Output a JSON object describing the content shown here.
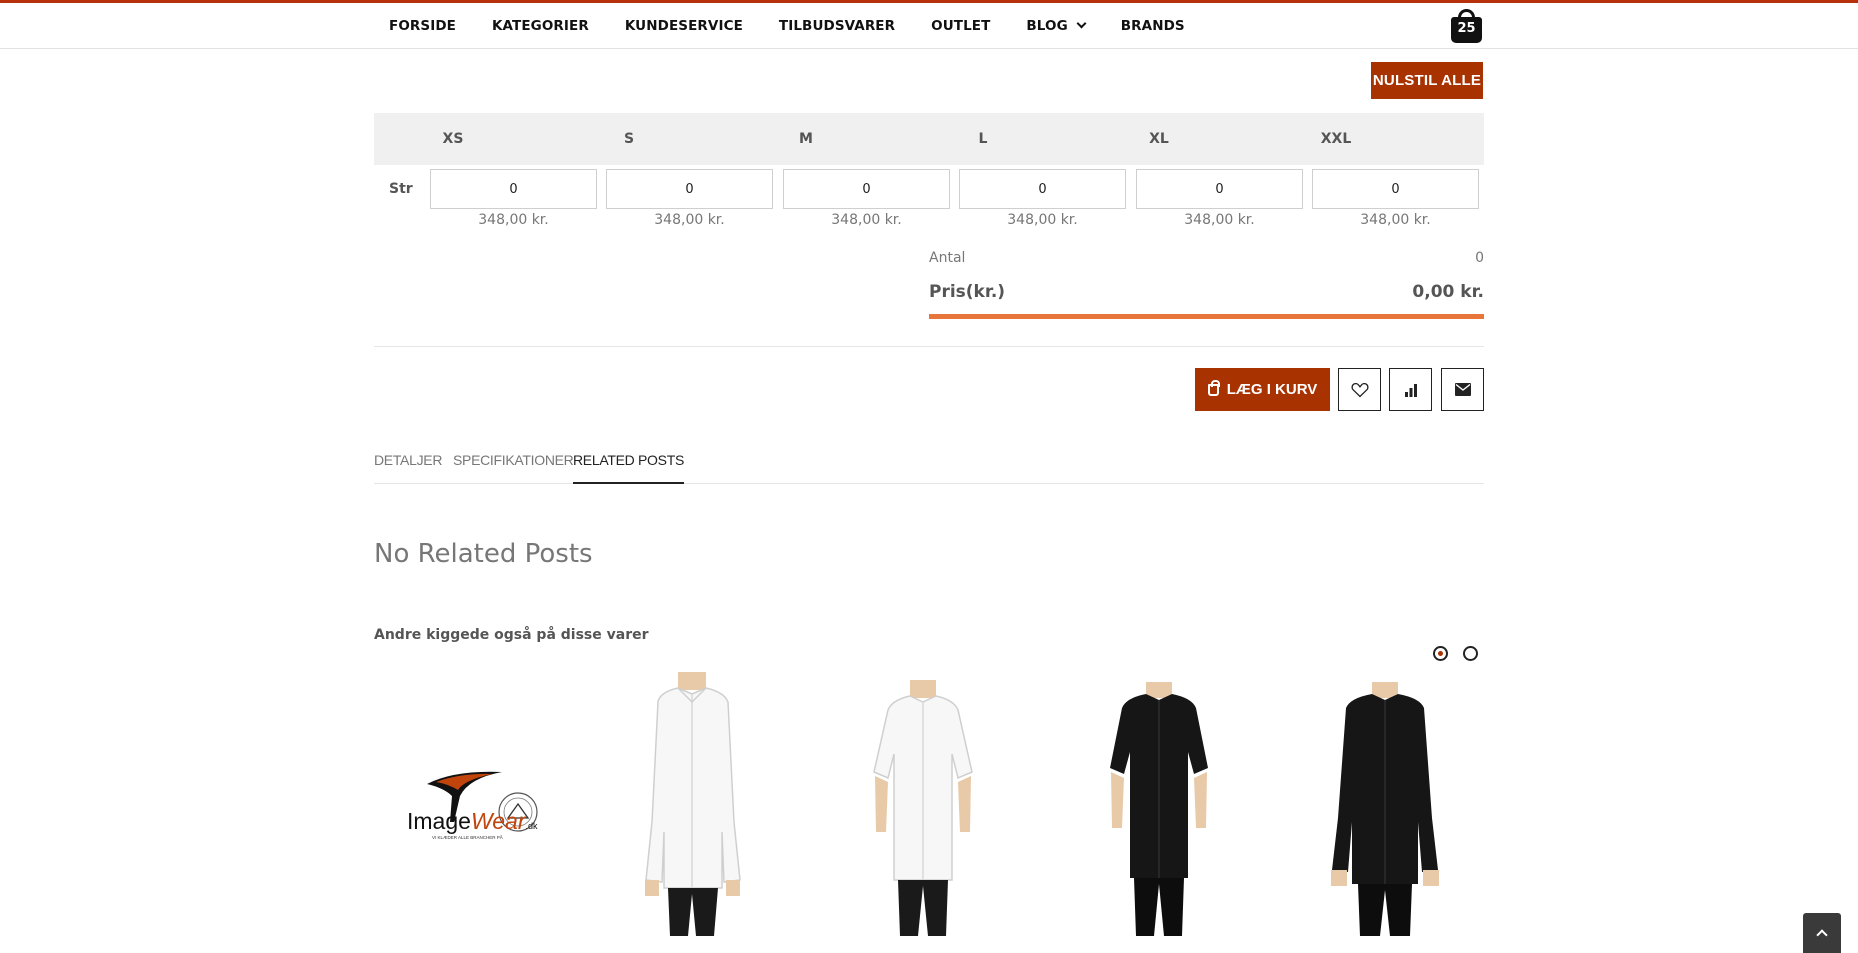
{
  "nav": {
    "items": [
      "FORSIDE",
      "KATEGORIER",
      "KUNDESERVICE",
      "TILBUDSVARER",
      "OUTLET",
      "BLOG",
      "BRANDS"
    ],
    "cart_count": "25"
  },
  "reset_button": "NULSTIL ALLE",
  "size_table": {
    "row_label": "Str",
    "sizes": [
      {
        "size": "XS",
        "qty": "0",
        "price": "348,00 kr."
      },
      {
        "size": "S",
        "qty": "0",
        "price": "348,00 kr."
      },
      {
        "size": "M",
        "qty": "0",
        "price": "348,00 kr."
      },
      {
        "size": "L",
        "qty": "0",
        "price": "348,00 kr."
      },
      {
        "size": "XL",
        "qty": "0",
        "price": "348,00 kr."
      },
      {
        "size": "XXL",
        "qty": "0",
        "price": "348,00 kr."
      }
    ]
  },
  "summary": {
    "antal_label": "Antal",
    "antal_value": "0",
    "pris_label": "Pris(kr.)",
    "pris_value": "0,00 kr."
  },
  "actions": {
    "add_to_cart": "LÆG I KURV",
    "wishlist_icon": "heart-icon",
    "compare_icon": "bar-chart-icon",
    "email_icon": "envelope-icon"
  },
  "tabs": [
    "DETALJER",
    "SPECIFIKATIONER",
    "RELATED POSTS"
  ],
  "active_tab": "RELATED POSTS",
  "related": {
    "heading": "No Related Posts"
  },
  "also_viewed": {
    "heading": "Andre kiggede også på disse varer",
    "logo_text": "ImageWear",
    "logo_suffix": ".dk",
    "logo_tagline": "VI KLÆDER ALLE BRANCHER PÅ",
    "products": [
      "white-long-sleeve-chef-jacket",
      "white-short-sleeve-chef-jacket",
      "black-short-sleeve-chef-jacket",
      "black-long-sleeve-chef-jacket"
    ]
  },
  "colors": {
    "accent": "#a83200",
    "progress": "#e8763a",
    "top_line": "#b5300b"
  }
}
